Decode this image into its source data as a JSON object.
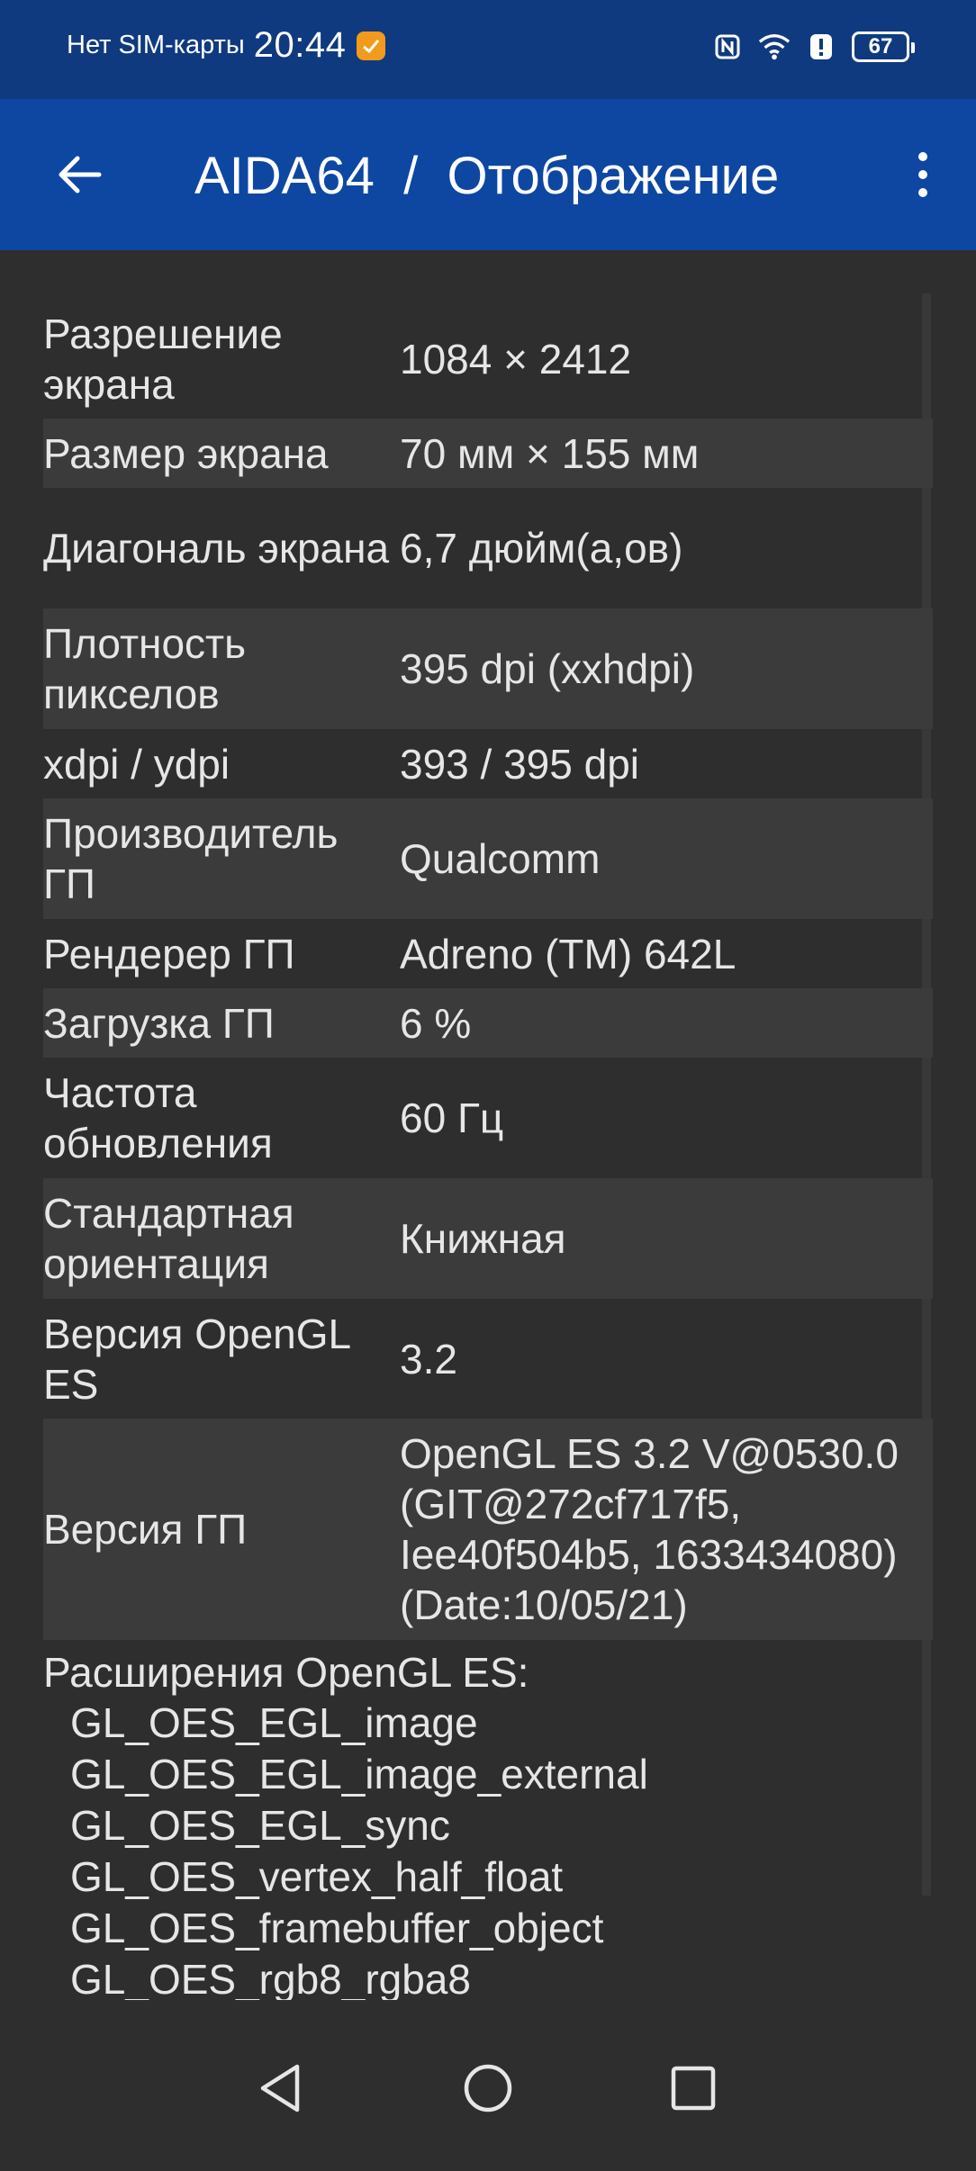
{
  "status_bar": {
    "carrier": "Нет SIM-карты",
    "time": "20:44",
    "battery": "67",
    "icons": [
      "app-notification-icon",
      "nfc-icon",
      "wifi-icon",
      "alert-icon",
      "battery-icon"
    ]
  },
  "app_bar": {
    "title": "AIDA64  /  Отображение",
    "back_icon": "arrow-left-icon",
    "menu_icon": "more-vert-icon",
    "background": "#0d47a1"
  },
  "rows": [
    {
      "label": "Разрешение экрана",
      "value": "1084 × 2412"
    },
    {
      "label": "Размер экрана",
      "value": "70 мм × 155 мм"
    },
    {
      "label": "Диагональ экрана",
      "value": "6,7 дюйм(а,ов)"
    },
    {
      "label": "Плотность пикселов",
      "value": "395 dpi (xxhdpi)"
    },
    {
      "label": "xdpi / ydpi",
      "value": "393 / 395 dpi"
    },
    {
      "label": "Производитель ГП",
      "value": "Qualcomm"
    },
    {
      "label": "Рендерер ГП",
      "value": "Adreno (TM) 642L"
    },
    {
      "label": "Загрузка ГП",
      "value": "6 %"
    },
    {
      "label": "Частота обновления",
      "value": "60 Гц"
    },
    {
      "label": "Стандартная ориентация",
      "value": "Книжная"
    },
    {
      "label": "Версия OpenGL ES",
      "value": "3.2"
    },
    {
      "label": "Версия ГП",
      "value": "OpenGL ES 3.2 V@0530.0 (GIT@272cf717f5, Iee40f504b5, 1633434080) (Date:10/05/21)"
    }
  ],
  "extensions": {
    "header": "Расширения OpenGL ES:",
    "items": [
      "GL_OES_EGL_image",
      "GL_OES_EGL_image_external",
      "GL_OES_EGL_sync",
      "GL_OES_vertex_half_float",
      "GL_OES_framebuffer_object",
      "GL_OES_rgb8_rgba8"
    ]
  },
  "nav_bar": {
    "buttons": [
      "back-triangle-icon",
      "home-circle-icon",
      "recents-square-icon"
    ]
  }
}
